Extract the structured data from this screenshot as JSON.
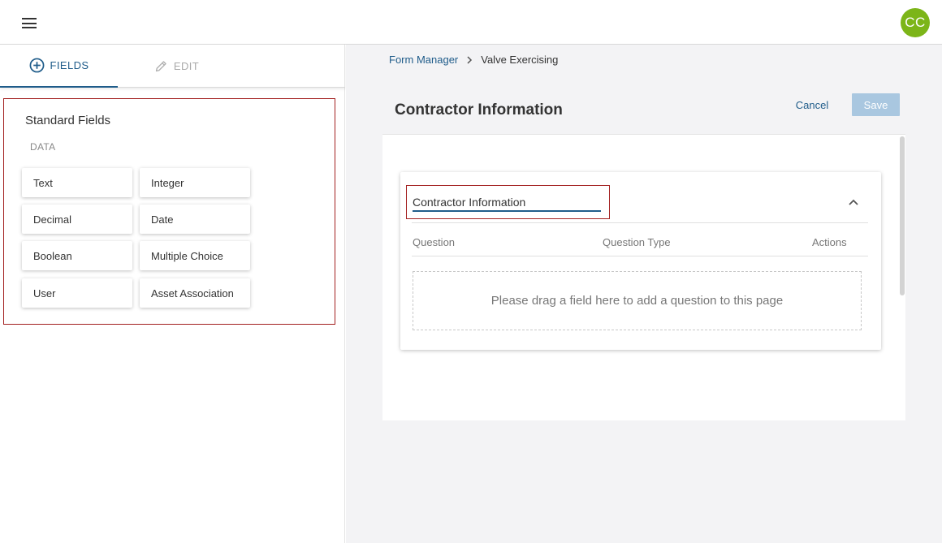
{
  "topbar": {
    "avatar_initials": "CC",
    "avatar_color": "#7cb518"
  },
  "left_panel": {
    "tabs": [
      {
        "label": "FIELDS",
        "icon": "plus-circle-icon",
        "active": true
      },
      {
        "label": "EDIT",
        "icon": "pencil-icon",
        "active": false
      }
    ],
    "section_title": "Standard Fields",
    "section_subtitle": "DATA",
    "fields": [
      "Text",
      "Integer",
      "Decimal",
      "Date",
      "Boolean",
      "Multiple Choice",
      "User",
      "Asset Association"
    ]
  },
  "header": {
    "breadcrumb": {
      "parent": "Form Manager",
      "current": "Valve Exercising"
    },
    "page_title": "Contractor Information",
    "cancel_label": "Cancel",
    "save_label": "Save"
  },
  "page_card": {
    "name_value": "Contractor Information",
    "columns": [
      "Question",
      "Question Type",
      "Actions"
    ],
    "dropzone_text": "Please drag a field here to add a question to this page"
  },
  "colors": {
    "primary": "#1f5c8a",
    "highlight_border": "#a32020",
    "save_disabled": "#a9c7e0",
    "content_bg": "#f3f3f5"
  }
}
